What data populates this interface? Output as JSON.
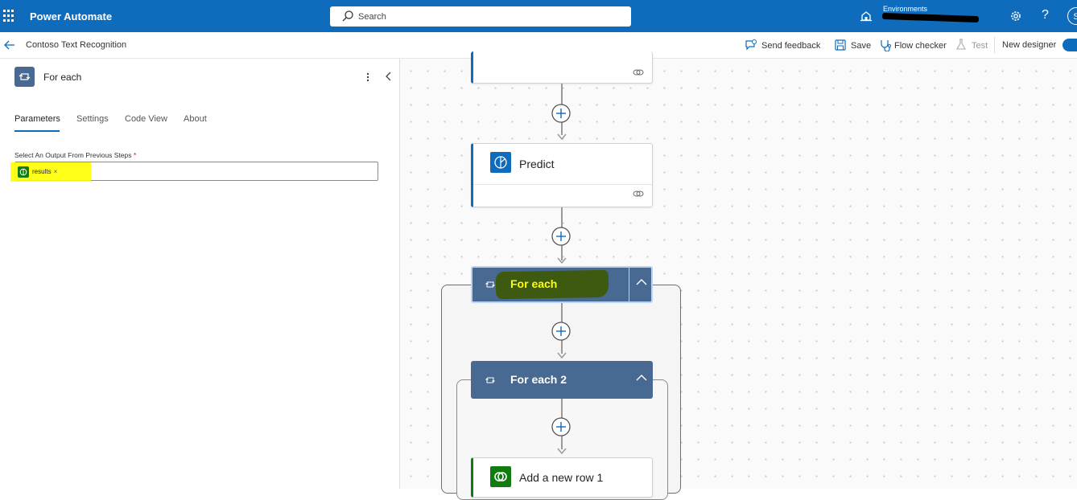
{
  "header": {
    "app_title": "Power Automate",
    "search_placeholder": "Search",
    "environments_label": "Environments",
    "avatar_initial": "S",
    "help_glyph": "?"
  },
  "command_bar": {
    "flow_name": "Contoso Text Recognition",
    "send_feedback": "Send feedback",
    "save": "Save",
    "flow_checker": "Flow checker",
    "test": "Test",
    "new_designer": "New designer",
    "new_designer_on": true
  },
  "panel": {
    "title": "For each",
    "tabs": [
      "Parameters",
      "Settings",
      "Code View",
      "About"
    ],
    "active_tab": "Parameters",
    "field_label": "Select An Output From Previous Steps",
    "field_required": "*",
    "token": {
      "label": "results",
      "remove": "×"
    }
  },
  "canvas": {
    "predict": "Predict",
    "for_each": "For each",
    "for_each_2": "For each 2",
    "add_row": "Add a new row 1"
  },
  "colors": {
    "brand_blue": "#0f6cbd",
    "loop_header": "#486991",
    "highlight": "#ffff00",
    "dataverse_green": "#107c10"
  },
  "icons": [
    "waffle-icon",
    "search-icon",
    "environment-icon",
    "gear-icon",
    "help-icon",
    "back-arrow-icon",
    "feedback-icon",
    "save-icon",
    "flow-checker-icon",
    "test-icon",
    "loop-icon",
    "more-icon",
    "collapse-icon",
    "ai-builder-icon",
    "link-icon",
    "plus-icon",
    "chevron-up-icon",
    "dataverse-icon"
  ]
}
